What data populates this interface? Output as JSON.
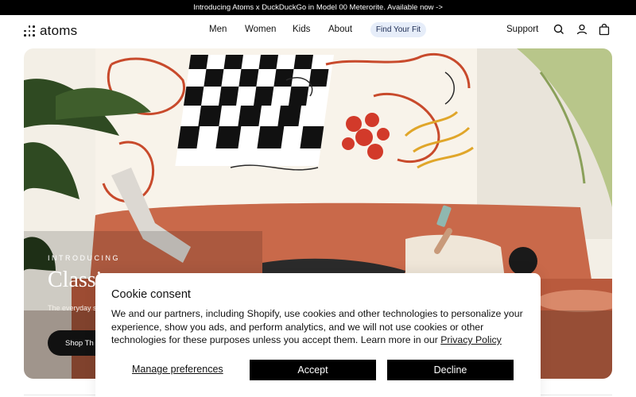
{
  "announcement": {
    "text": "Introducing Atoms x DuckDuckGo in Model 00 Meterorite. Available now ->"
  },
  "brand": {
    "name": "atoms"
  },
  "nav": {
    "items": [
      {
        "label": "Men"
      },
      {
        "label": "Women"
      },
      {
        "label": "Kids"
      },
      {
        "label": "About"
      }
    ],
    "fit_label": "Find Your Fit",
    "support_label": "Support",
    "icons": [
      "search-icon",
      "account-icon",
      "bag-icon"
    ]
  },
  "hero": {
    "eyebrow": "INTRODUCING",
    "title": "Classic",
    "subtitle": "The everyday s",
    "cta_label": "Shop Th"
  },
  "cookie": {
    "title": "Cookie consent",
    "body": "We and our partners, including Shopify, use cookies and other technologies to personalize your experience, show you ads, and perform analytics, and we will not use cookies or other technologies for these purposes unless you accept them. Learn more in our ",
    "policy_link": "Privacy Policy",
    "manage_label": "Manage preferences",
    "accept_label": "Accept",
    "decline_label": "Decline"
  },
  "colors": {
    "announcement_bg": "#000000",
    "fit_button_bg": "#e6edf9",
    "primary_button": "#000000",
    "sofa": "#c9694a",
    "wall": "#f3efe6"
  }
}
